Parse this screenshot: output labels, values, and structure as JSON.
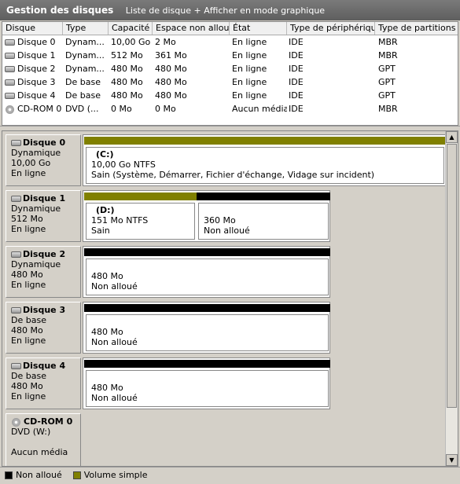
{
  "title": {
    "main": "Gestion des disques",
    "subtitle": "Liste de disque + Afficher en mode graphique"
  },
  "list": {
    "headers": [
      "Disque",
      "Type",
      "Capacité",
      "Espace non alloué",
      "État",
      "Type de périphérique",
      "Type de partitions"
    ],
    "rows": [
      {
        "icon": "disk-icon",
        "cells": [
          "Disque 0",
          "Dynam...",
          "10,00 Go",
          "2 Mo",
          "En ligne",
          "IDE",
          "MBR"
        ]
      },
      {
        "icon": "disk-icon",
        "cells": [
          "Disque 1",
          "Dynam...",
          "512 Mo",
          "361 Mo",
          "En ligne",
          "IDE",
          "MBR"
        ]
      },
      {
        "icon": "disk-icon",
        "cells": [
          "Disque 2",
          "Dynam...",
          "480 Mo",
          "480 Mo",
          "En ligne",
          "IDE",
          "GPT"
        ]
      },
      {
        "icon": "disk-icon",
        "cells": [
          "Disque 3",
          "De base",
          "480 Mo",
          "480 Mo",
          "En ligne",
          "IDE",
          "GPT"
        ]
      },
      {
        "icon": "disk-icon",
        "cells": [
          "Disque 4",
          "De base",
          "480 Mo",
          "480 Mo",
          "En ligne",
          "IDE",
          "GPT"
        ]
      },
      {
        "icon": "cdrom-icon",
        "cells": [
          "CD-ROM 0",
          "DVD (...",
          "0 Mo",
          "0 Mo",
          "Aucun média",
          "IDE",
          "MBR"
        ]
      }
    ]
  },
  "graph": {
    "disks": [
      {
        "name": "Disque 0",
        "type": "Dynamique",
        "size": "10,00 Go",
        "status": "En ligne",
        "volumes": [
          {
            "color": "#808000",
            "name": "(C:)",
            "line1": "10,00 Go NTFS",
            "line2": "Sain (Système, Démarrer, Fichier d'échange, Vidage sur incident)"
          }
        ]
      },
      {
        "name": "Disque 1",
        "type": "Dynamique",
        "size": "512 Mo",
        "status": "En ligne",
        "volumes": [
          {
            "color": "#808000",
            "name": "(D:)",
            "line1": "151 Mo NTFS",
            "line2": "Sain"
          },
          {
            "color": "#000000",
            "name": "",
            "line1": "360 Mo",
            "line2": "Non alloué"
          }
        ]
      },
      {
        "name": "Disque 2",
        "type": "Dynamique",
        "size": "480 Mo",
        "status": "En ligne",
        "volumes": [
          {
            "color": "#000000",
            "name": "",
            "line1": "480 Mo",
            "line2": "Non alloué"
          }
        ]
      },
      {
        "name": "Disque 3",
        "type": "De base",
        "size": "480 Mo",
        "status": "En ligne",
        "volumes": [
          {
            "color": "#000000",
            "name": "",
            "line1": "480 Mo",
            "line2": "Non alloué"
          }
        ]
      },
      {
        "name": "Disque 4",
        "type": "De base",
        "size": "480 Mo",
        "status": "En ligne",
        "volumes": [
          {
            "color": "#000000",
            "name": "",
            "line1": "480 Mo",
            "line2": "Non alloué"
          }
        ]
      }
    ],
    "cdrom": {
      "name": "CD-ROM 0",
      "type": "DVD (W:)",
      "status": "Aucun média"
    }
  },
  "legend": [
    {
      "color": "#000000",
      "label": "Non alloué"
    },
    {
      "color": "#808000",
      "label": "Volume simple"
    }
  ]
}
